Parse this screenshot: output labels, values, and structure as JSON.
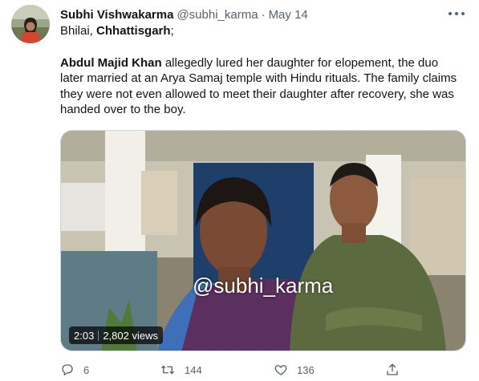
{
  "tweet": {
    "author": {
      "display_name": "Subhi Vishwakarma",
      "handle": "@subhi_karma",
      "separator": "·",
      "date": "May 14"
    },
    "text": {
      "line1_plain": "Bhilai, ",
      "line1_bold": "Chhattisgarh",
      "line1_tail": ";",
      "para2_bold": "Abdul Majid Khan",
      "para2_rest": " allegedly lured her daughter for elopement, the duo later married at an Arya Samaj temple with Hindu rituals. The family claims they were not even allowed to meet their daughter after recovery, she was handed over to the boy."
    },
    "media": {
      "watermark": "@subhi_karma",
      "duration": "2:03",
      "views": "2,802 views"
    },
    "actions": {
      "reply_count": "6",
      "retweet_count": "144",
      "like_count": "136"
    },
    "icons": {
      "more": "more-horizontal-icon",
      "reply": "reply-icon",
      "retweet": "retweet-icon",
      "like": "heart-icon",
      "share": "share-icon"
    },
    "colors": {
      "text_primary": "#0f1419",
      "text_secondary": "#536471",
      "border": "#cfd9de"
    }
  }
}
